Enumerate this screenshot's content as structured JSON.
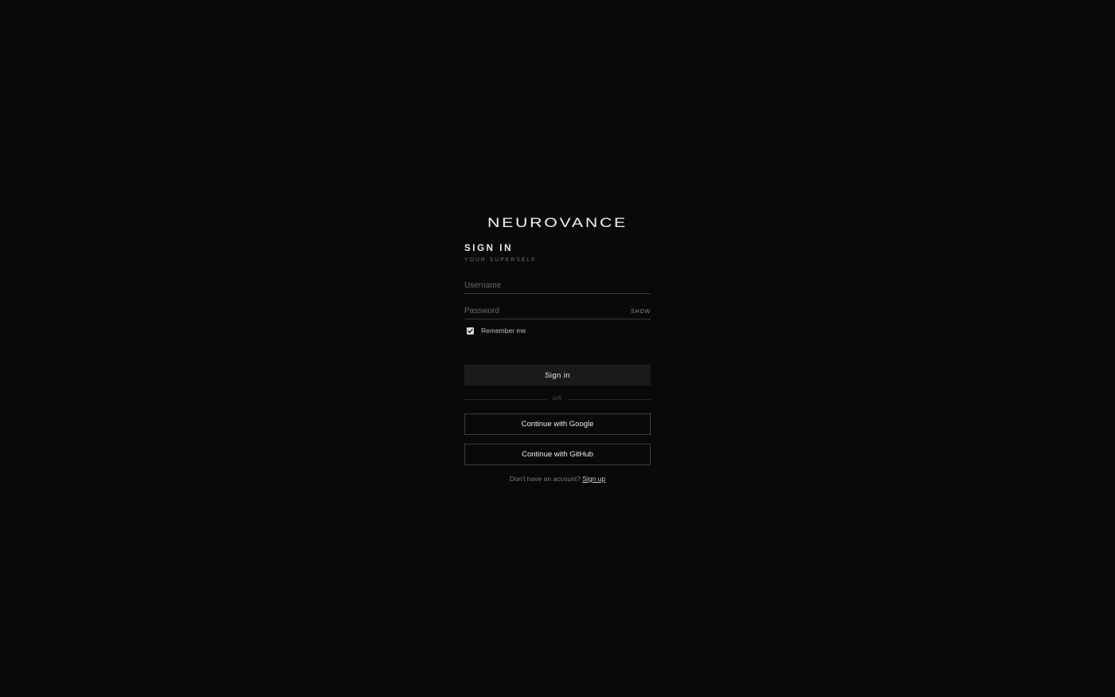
{
  "brand": {
    "logo_text": "NEUROVANCE"
  },
  "form": {
    "title": "SIGN IN",
    "subtitle": "YOUR SUPERSELF",
    "username": {
      "placeholder": "Username",
      "value": ""
    },
    "password": {
      "placeholder": "Password",
      "value": "",
      "show_toggle_label": "SHOW"
    },
    "remember": {
      "label": "Remember me",
      "checked": true
    },
    "submit_label": "Sign in",
    "divider_text": "OR",
    "google_label": "Continue with Google",
    "github_label": "Continue with GitHub",
    "signup_prompt": "Don't have an account?",
    "signup_link": "Sign up"
  },
  "colors": {
    "background": "#090909",
    "primary_button": "#1a1a1a",
    "text": "#e8e8e8",
    "muted_text": "#7c7c7c"
  }
}
